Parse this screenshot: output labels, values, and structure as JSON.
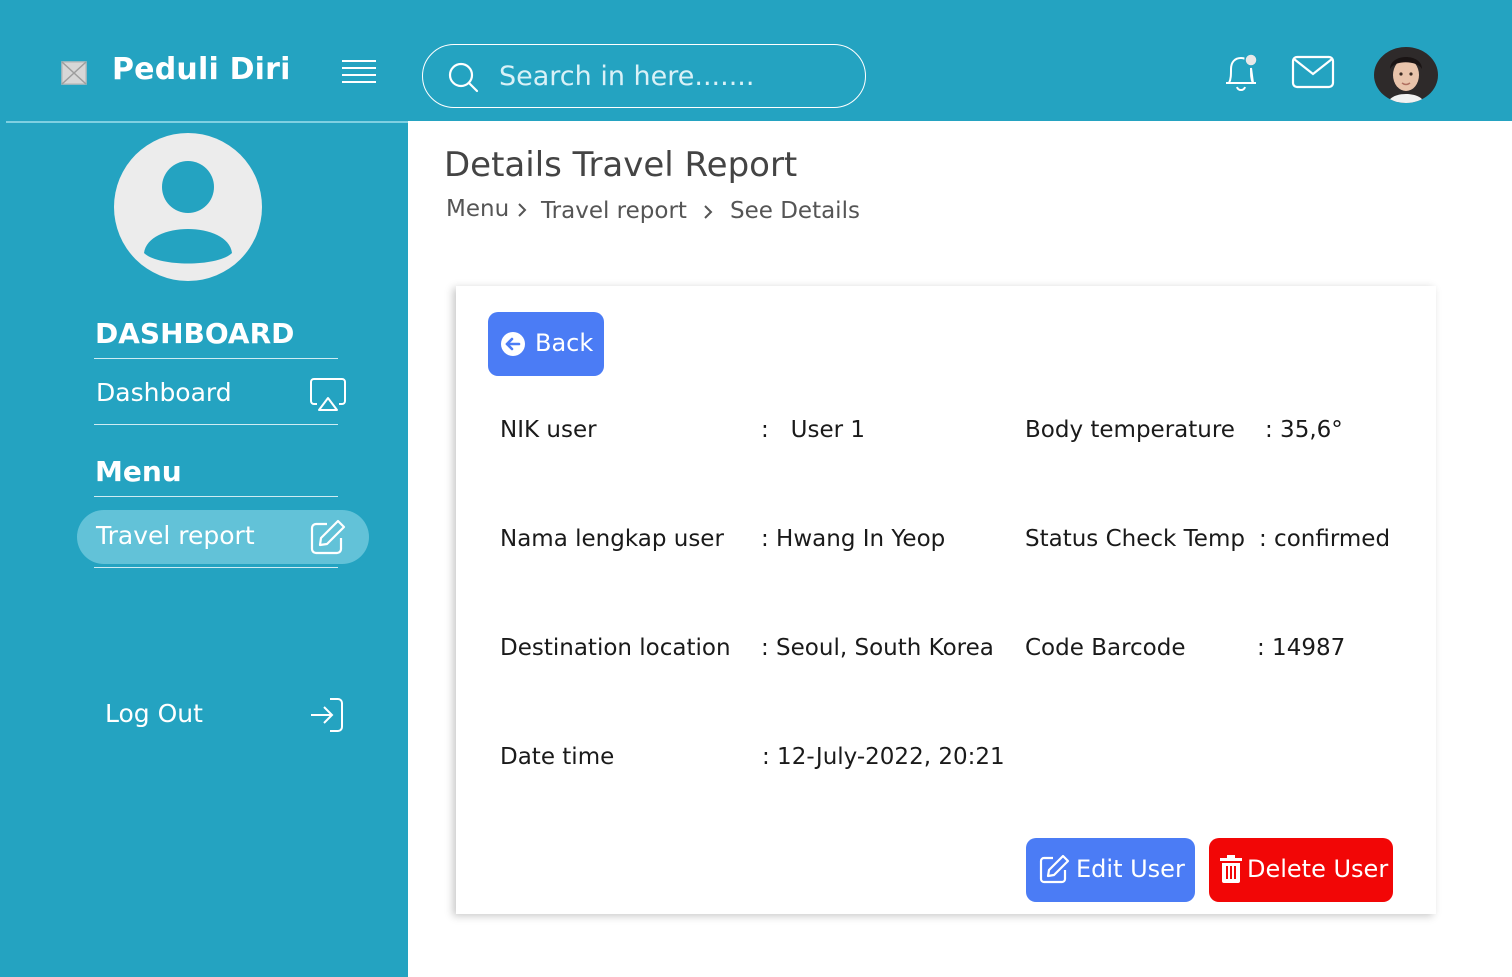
{
  "header": {
    "brand": "Peduli Diri",
    "search_placeholder": "Search in here......."
  },
  "sidebar": {
    "section_dashboard": "DASHBOARD",
    "dashboard_item": "Dashboard",
    "section_menu": "Menu",
    "travel_item": "Travel report",
    "logout": "Log Out"
  },
  "page": {
    "title": "Details Travel Report",
    "breadcrumb": [
      "Menu",
      "Travel report",
      "See Details"
    ],
    "back_label": "Back"
  },
  "details": {
    "nik_label": "NIK user",
    "nik_value": ":   User 1",
    "temp_label": "Body temperature",
    "temp_value": ": 35,6°",
    "name_label": "Nama lengkap user",
    "name_value": ": Hwang In Yeop",
    "status_label": "Status Check Temp",
    "status_value": ": confirmed",
    "dest_label": "Destination location",
    "dest_value": ": Seoul, South Korea",
    "barcode_label": "Code Barcode",
    "barcode_value": ": 14987",
    "date_label": "Date time",
    "date_value": ": 12-July-2022, 20:21"
  },
  "actions": {
    "edit_label": "Edit User",
    "delete_label": "Delete User"
  },
  "colors": {
    "primary": "#24a3c1",
    "button_blue": "#4b7cf5",
    "button_red": "#f20606",
    "active_item": "#62c2d8"
  }
}
